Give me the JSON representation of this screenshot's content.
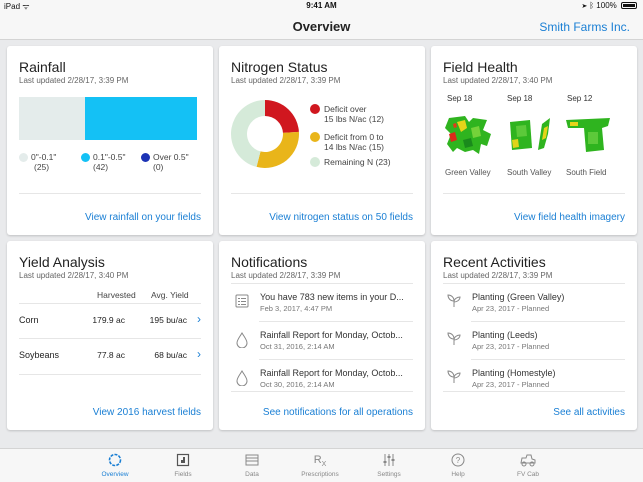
{
  "status_bar": {
    "carrier": "iPad ᯤ",
    "time": "9:41 AM",
    "battery": "100%"
  },
  "header": {
    "title": "Overview",
    "org": "Smith Farms Inc."
  },
  "rainfall": {
    "title": "Rainfall",
    "updated": "Last updated 2/28/17, 3:39 PM",
    "segments": [
      {
        "label": "0\"-0.1\"",
        "count": "(25)",
        "value": 25,
        "color": "#e4eceb"
      },
      {
        "label": "0.1\"-0.5\"",
        "count": "(42)",
        "value": 42,
        "color": "#14c1f5"
      },
      {
        "label": "Over 0.5\"",
        "count": "(0)",
        "value": 0,
        "color": "#1c33b5"
      }
    ],
    "link": "View rainfall on your fields"
  },
  "nitrogen": {
    "title": "Nitrogen Status",
    "updated": "Last updated 2/28/17, 3:39 PM",
    "legend": [
      {
        "line1": "Deficit over",
        "line2": "15 lbs N/ac (12)",
        "value": 12,
        "color": "#d0171f"
      },
      {
        "line1": "Deficit from 0 to",
        "line2": "14 lbs N/ac (15)",
        "value": 15,
        "color": "#e9b51a"
      },
      {
        "line1": "Remaining N (23)",
        "line2": "",
        "value": 23,
        "color": "#d5ead9"
      }
    ],
    "link": "View nitrogen status on 50 fields"
  },
  "field_health": {
    "title": "Field Health",
    "updated": "Last updated 2/28/17, 3:40 PM",
    "fields": [
      {
        "date": "Sep 18",
        "name": "Green Valley"
      },
      {
        "date": "Sep 18",
        "name": "South Valley"
      },
      {
        "date": "Sep 12",
        "name": "South Field"
      }
    ],
    "link": "View field health imagery"
  },
  "yield": {
    "title": "Yield Analysis",
    "updated": "Last updated 2/28/17, 3:40 PM",
    "columns": {
      "harvested": "Harvested",
      "avg": "Avg. Yield"
    },
    "rows": [
      {
        "crop": "Corn",
        "harvested": "179.9 ac",
        "avg": "195 bu/ac"
      },
      {
        "crop": "Soybeans",
        "harvested": "77.8 ac",
        "avg": "68 bu/ac"
      }
    ],
    "link": "View 2016 harvest fields"
  },
  "notifications": {
    "title": "Notifications",
    "updated": "Last updated 2/28/17, 3:39 PM",
    "items": [
      {
        "icon": "checklist-icon",
        "text": "You have 783 new items in your D...",
        "date": "Feb 3, 2017, 4:47 PM"
      },
      {
        "icon": "raindrop-icon",
        "text": "Rainfall Report for Monday, Octob...",
        "date": "Oct 31, 2016, 2:14 AM"
      },
      {
        "icon": "raindrop-icon",
        "text": "Rainfall Report for Monday, Octob...",
        "date": "Oct 30, 2016, 2:14 AM"
      }
    ],
    "link": "See notifications for all operations"
  },
  "activities": {
    "title": "Recent Activities",
    "updated": "Last updated 2/28/17, 3:39 PM",
    "items": [
      {
        "icon": "seedling-icon",
        "text": "Planting (Green Valley)",
        "date": "Apr 23, 2017 - Planned"
      },
      {
        "icon": "seedling-icon",
        "text": "Planting (Leeds)",
        "date": "Apr 23, 2017 - Planned"
      },
      {
        "icon": "seedling-icon",
        "text": "Planting (Homestyle)",
        "date": "Apr 23, 2017 - Planned"
      }
    ],
    "link": "See all activities"
  },
  "tabs": [
    {
      "label": "Overview",
      "icon": "overview-icon",
      "active": true
    },
    {
      "label": "Fields",
      "icon": "fields-icon"
    },
    {
      "label": "Data",
      "icon": "data-icon"
    },
    {
      "label": "Prescriptions",
      "icon": "prescriptions-icon"
    },
    {
      "label": "Settings",
      "icon": "settings-icon"
    },
    {
      "label": "Help",
      "icon": "help-icon"
    },
    {
      "label": "FV Cab",
      "icon": "cab-icon"
    }
  ],
  "colors": {
    "accent": "#1a7fd4"
  }
}
